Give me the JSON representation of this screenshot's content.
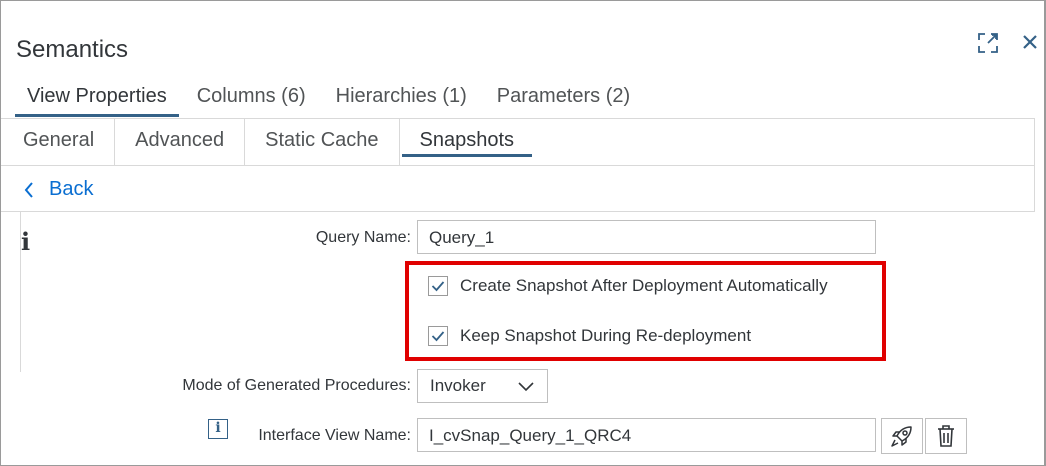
{
  "panel": {
    "title": "Semantics",
    "expand_icon": "expand-icon",
    "close_icon": "close-icon"
  },
  "main_tabs": [
    {
      "label": "View Properties",
      "active": true
    },
    {
      "label": "Columns (6)",
      "active": false
    },
    {
      "label": "Hierarchies (1)",
      "active": false
    },
    {
      "label": "Parameters (2)",
      "active": false
    }
  ],
  "sub_tabs": [
    {
      "label": "General",
      "active": false
    },
    {
      "label": "Advanced",
      "active": false
    },
    {
      "label": "Static Cache",
      "active": false
    },
    {
      "label": "Snapshots",
      "active": true
    }
  ],
  "back": {
    "label": "Back",
    "icon": "chevron-left-icon"
  },
  "info_icon": "information-icon",
  "form": {
    "query_name": {
      "label": "Query Name:",
      "value": "Query_1"
    },
    "create_snapshot": {
      "label": "Create Snapshot After Deployment Automatically",
      "checked": true
    },
    "keep_snapshot": {
      "label": "Keep Snapshot During Re-deployment",
      "checked": true
    },
    "mode": {
      "label": "Mode of Generated Procedures:",
      "value": "Invoker"
    },
    "interface_view": {
      "label": "Interface View Name:",
      "value": "I_cvSnap_Query_1_QRC4",
      "info_icon": "info-icon",
      "rocket_icon": "rocket-icon",
      "trash_icon": "trash-icon"
    }
  },
  "colors": {
    "accent": "#346187",
    "link": "#0a6ed1",
    "highlight": "#e00000",
    "text": "#32363a",
    "border": "#bfbfbf"
  }
}
